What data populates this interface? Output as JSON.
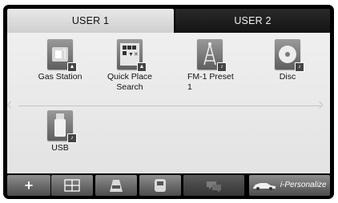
{
  "tabs": {
    "user1": "USER 1",
    "user2": "USER 2"
  },
  "nav": {
    "left_arrow": "‹",
    "right_arrow": "›"
  },
  "items": [
    {
      "label": "Gas Station",
      "icon": "gas-station-icon",
      "badge": "map-badge"
    },
    {
      "label": "Quick Place Search",
      "icon": "quick-place-search-icon",
      "badge": "map-badge"
    },
    {
      "label": "FM-1 Preset 1",
      "icon": "fm-preset-icon",
      "badge": "music-badge"
    },
    {
      "label": "Disc",
      "icon": "disc-icon",
      "badge": "music-badge"
    },
    {
      "label": "USB",
      "icon": "usb-icon",
      "badge": "music-badge"
    }
  ],
  "bottom_bar": {
    "add_symbol": "+",
    "personalize_label": "i-Personalize",
    "icons": [
      "add-icon",
      "move-icon",
      "front-view-camera-icon",
      "rear-view-camera-icon",
      "chat-icon",
      "car-icon"
    ]
  }
}
